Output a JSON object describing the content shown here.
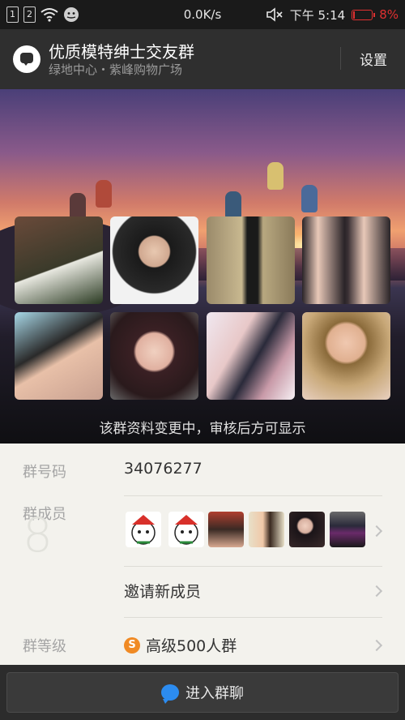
{
  "status_bar": {
    "sim1": "1",
    "sim2": "2",
    "speed": "0.0K/s",
    "time": "下午 5:14",
    "battery": "8%",
    "battery_level": 0.08,
    "icons": [
      "sim-1-icon",
      "sim-2-icon",
      "wifi-icon",
      "notification-face-icon",
      "mute-icon",
      "battery-icon"
    ]
  },
  "header": {
    "title": "优质模特绅士交友群",
    "subtitle": "绿地中心・紫峰购物广场",
    "settings": "设置",
    "icon": "chat-group-icon"
  },
  "banner": {
    "notice": "该群资料变更中，审核后方可显示",
    "photo_count": 8
  },
  "info": {
    "group_id_label": "群号码",
    "group_id": "34076277",
    "members_label": "群成员",
    "members_count": "8",
    "member_avatar_count": 6,
    "invite_label": "邀请新成员",
    "level_label": "群等级",
    "level_badge": "S",
    "level_value": "高级500人群"
  },
  "bottom": {
    "enter_label": "进入群聊",
    "icon": "chat-bubble-icon"
  },
  "colors": {
    "header_bg": "#2f2f2f",
    "status_bg": "#1a1a1a",
    "battery_low": "#e03030",
    "accent_blue": "#2c8cf0",
    "badge_orange": "#f08a24"
  }
}
